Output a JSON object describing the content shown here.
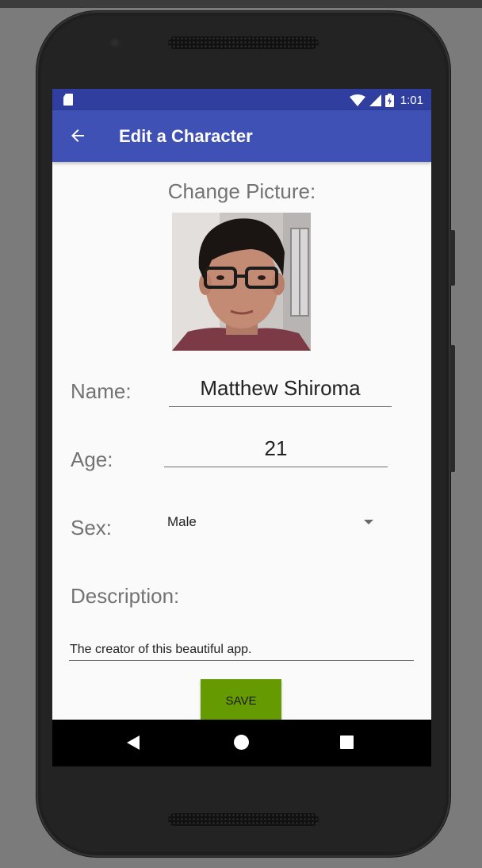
{
  "statusbar": {
    "time": "1:01",
    "icons": [
      "sd-card-icon",
      "wifi-icon",
      "cell-signal-icon",
      "battery-icon"
    ]
  },
  "appbar": {
    "title": "Edit a Character",
    "back_icon": "arrow-back-icon"
  },
  "form": {
    "change_picture_label": "Change Picture:",
    "name_label": "Name:",
    "name_value": "Matthew Shiroma",
    "age_label": "Age:",
    "age_value": "21",
    "sex_label": "Sex:",
    "sex_value": "Male",
    "description_label": "Description:",
    "description_value": "The creator of this beautiful app.",
    "save_label": "SAVE"
  },
  "navbar": {
    "icons": [
      "nav-back-icon",
      "nav-home-icon",
      "nav-recents-icon"
    ]
  },
  "colors": {
    "statusbar": "#303f9f",
    "appbar": "#3f51b5",
    "save_button": "#659a00",
    "label_text": "#737373"
  }
}
